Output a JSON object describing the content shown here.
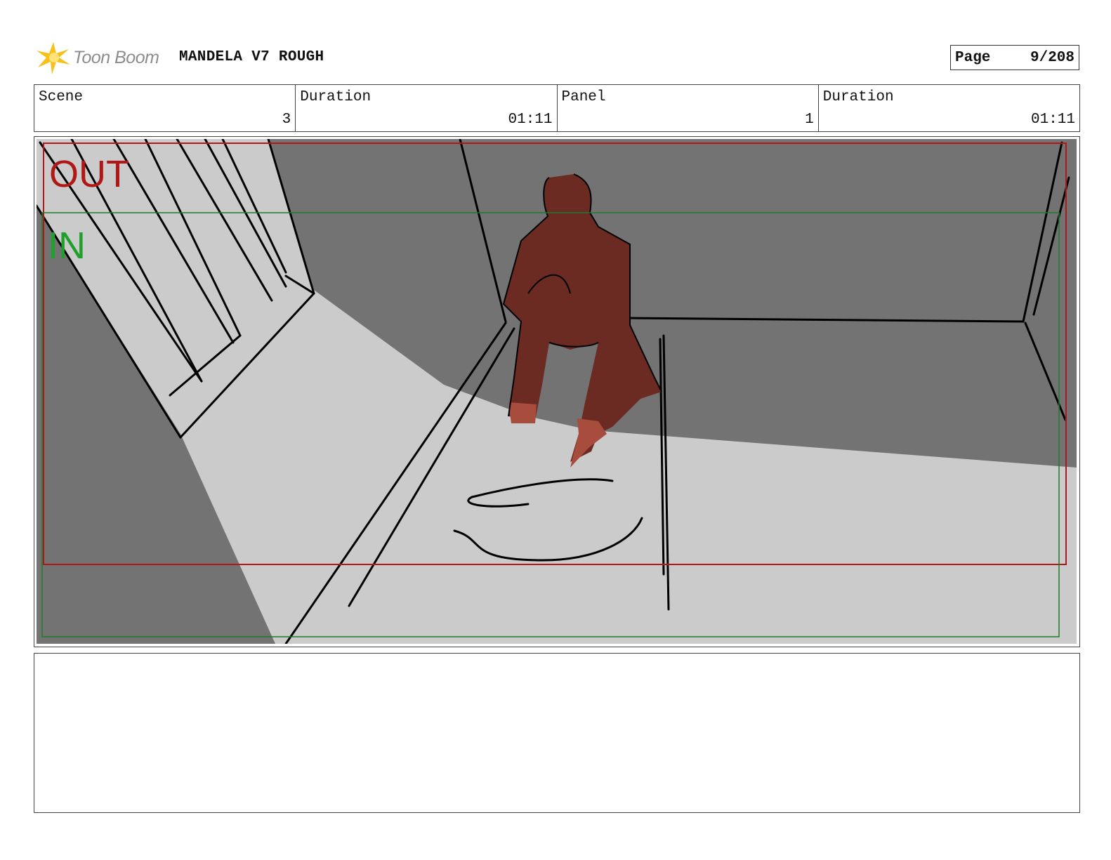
{
  "header": {
    "logo_text": "Toon Boom",
    "project_title": "MANDELA V7 ROUGH",
    "page_label": "Page",
    "page_value": "9/208"
  },
  "info": {
    "scene_label": "Scene",
    "scene_value": "3",
    "scene_duration_label": "Duration",
    "scene_duration_value": "01:11",
    "panel_label": "Panel",
    "panel_value": "1",
    "panel_duration_label": "Duration",
    "panel_duration_value": "01:11"
  },
  "panel": {
    "out_label": "OUT",
    "in_label": "IN",
    "colors": {
      "wall_dark": "#737373",
      "floor_light": "#cbcbcb",
      "figure": "#6b2a22",
      "figure_highlight": "#a84c3d",
      "out_frame": "#b01818",
      "in_frame": "#1f7a2a"
    }
  },
  "notes": {
    "text": ""
  }
}
